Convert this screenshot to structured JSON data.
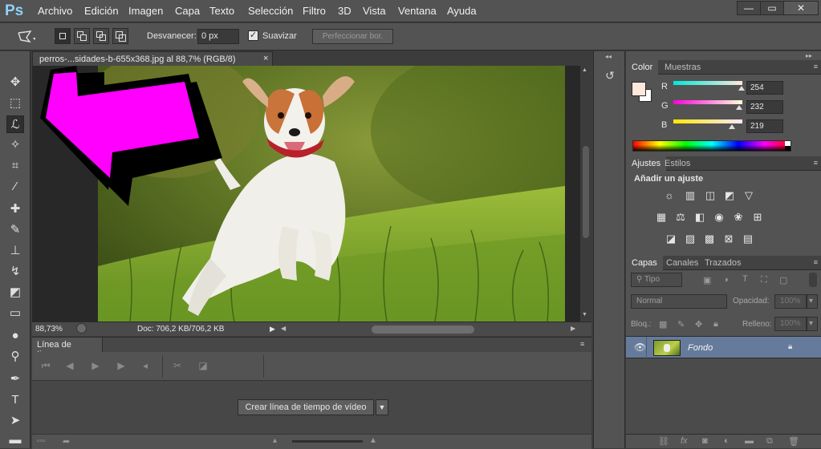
{
  "app": {
    "logo": "Ps"
  },
  "menu": [
    "Archivo",
    "Edición",
    "Imagen",
    "Capa",
    "Texto",
    "Selección",
    "Filtro",
    "3D",
    "Vista",
    "Ventana",
    "Ayuda"
  ],
  "window_controls": {
    "minimize": "—",
    "restore": "▭",
    "close": "✕"
  },
  "options": {
    "feather_label": "Desvanecer:",
    "feather_value": "0 px",
    "antialias_label": "Suavizar",
    "antialias_checked": true,
    "refine_edge": "Perfeccionar bor."
  },
  "document": {
    "tab_title": "perros-...sidades-b-655x368.jpg al 88,7% (RGB/8)",
    "tab_close": "×",
    "zoom": "88,73%",
    "doc_info": "Doc: 706,2 KB/706,2 KB"
  },
  "timeline": {
    "tab_label": "Línea de tiempo",
    "create_button": "Crear línea de tiempo de vídeo"
  },
  "color_panel": {
    "tabs": [
      "Color",
      "Muestras"
    ],
    "r_label": "R",
    "g_label": "G",
    "b_label": "B",
    "r": 254,
    "g": 232,
    "b": 219,
    "foreground": "#fee8db",
    "background": "#ffffff"
  },
  "adjustments_panel": {
    "tabs": [
      "Ajustes",
      "Estilos"
    ],
    "heading": "Añadir un ajuste"
  },
  "layers_panel": {
    "tabs": [
      "Capas",
      "Canales",
      "Trazados"
    ],
    "filter_label": "Tipo",
    "blend_mode": "Normal",
    "opacity_label": "Opacidad:",
    "opacity_value": "100%",
    "lock_label": "Bloq.:",
    "fill_label": "Relleno:",
    "fill_value": "100%",
    "layers": [
      {
        "name": "Fondo",
        "visible": true,
        "locked": true
      }
    ]
  },
  "colors": {
    "arrow": "#ff00ff",
    "selected_layer": "#667b9c"
  }
}
